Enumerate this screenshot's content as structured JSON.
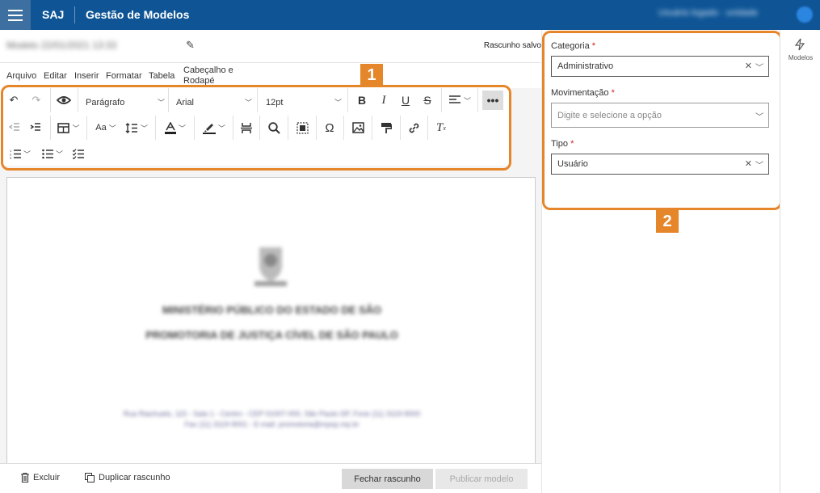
{
  "header": {
    "brand": "SAJ",
    "title": "Gestão de Modelos",
    "user": "Usuário logado · unidade"
  },
  "document": {
    "name": "Modelo 22/01/2021 13:33",
    "status": "Rascunho salvo"
  },
  "menu": [
    "Arquivo",
    "Editar",
    "Inserir",
    "Formatar",
    "Tabela",
    "Cabeçalho e Rodapé"
  ],
  "toolbar": {
    "paragraph": "Parágrafo",
    "font": "Arial",
    "size": "12pt",
    "case": "Aa"
  },
  "page_content": {
    "line1": "MINISTÉRIO PÚBLICO DO ESTADO DE SÃO",
    "line2": "PROMOTORIA DE JUSTIÇA CÍVEL DE SÃO PAULO",
    "address1": "Rua Riachuelo, 115 - Sala 1 - Centro - CEP 01007-000, São Paulo-SP, Fone (11) 3119-9000",
    "address2": "Fax (11) 3119-9001 - E-mail: promotoria@mpsp.mp.br"
  },
  "bottom": {
    "delete": "Excluir",
    "duplicate": "Duplicar rascunho",
    "close": "Fechar rascunho",
    "publish": "Publicar modelo"
  },
  "side": {
    "categoria_label": "Categoria",
    "categoria_value": "Administrativo",
    "movimentacao_label": "Movimentação",
    "movimentacao_placeholder": "Digite e selecione a opção",
    "tipo_label": "Tipo",
    "tipo_value": "Usuário",
    "required": "*"
  },
  "rail": {
    "label": "Modelos"
  },
  "annotations": {
    "one": "1",
    "two": "2"
  },
  "colors": {
    "header": "#0f5596",
    "highlight": "#e6862a"
  }
}
